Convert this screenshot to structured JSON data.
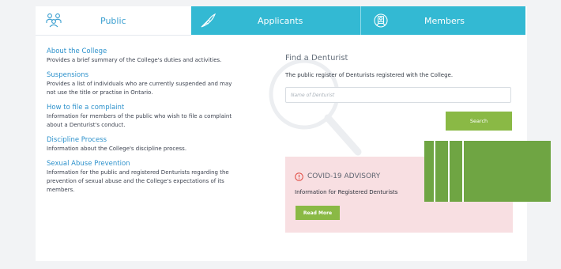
{
  "tabs": [
    {
      "label": "Public",
      "icon": "people-group-icon"
    },
    {
      "label": "Applicants",
      "icon": "quill-pen-icon"
    },
    {
      "label": "Members",
      "icon": "member-card-icon"
    }
  ],
  "links": [
    {
      "title": "About the College",
      "description": "Provides a brief summary of the College's duties and activities."
    },
    {
      "title": "Suspensions",
      "description": "Provides a list of individuals who are currently suspended and may not use the title or practise in Ontario."
    },
    {
      "title": "How to file a complaint",
      "description": "Information for members of the public who wish to file a complaint about a Denturist's conduct."
    },
    {
      "title": "Discipline Process",
      "description": "Information about the College's discipline process."
    },
    {
      "title": "Sexual Abuse Prevention",
      "description": "Information for the public and registered Denturists regarding the prevention of sexual abuse and the College's expectations of its members."
    }
  ],
  "find": {
    "title": "Find a Denturist",
    "description": "The public register of Denturists registered with the College.",
    "placeholder": "Name of Denturist",
    "search_label": "Search"
  },
  "advisory": {
    "title": "COVID-19 ADVISORY",
    "text": "Information for Registered Denturists",
    "button_label": "Read More"
  },
  "colors": {
    "tab_active_bg": "#ffffff",
    "tab_bg": "#33b9d3",
    "link_color": "#2e92cc",
    "button_green": "#8ab945",
    "advisory_bg": "#f8dfe2",
    "overlay_green": "#6fa543"
  }
}
